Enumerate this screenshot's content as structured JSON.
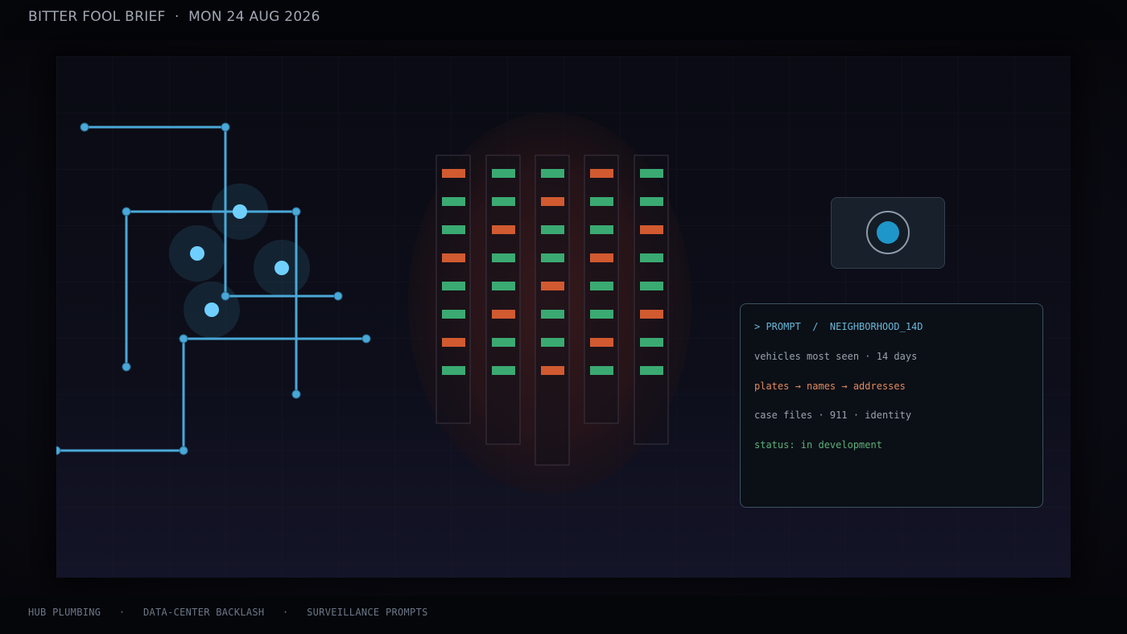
{
  "header": {
    "title": "BITTER FOOL BRIEF  ·  MON 24 AUG 2026"
  },
  "illustration": {
    "circuit_color": "#4aa8d8",
    "node_glow_color": "#6fd0ff",
    "plate_green": "#3aaa72",
    "plate_orange": "#d15a30",
    "plate_columns": [
      [
        "orange",
        "green",
        "green",
        "orange",
        "green",
        "green",
        "orange",
        "green"
      ],
      [
        "green",
        "green",
        "orange",
        "green",
        "green",
        "orange",
        "green",
        "green"
      ],
      [
        "green",
        "orange",
        "green",
        "green",
        "orange",
        "green",
        "green",
        "orange"
      ],
      [
        "orange",
        "green",
        "green",
        "orange",
        "green",
        "green",
        "orange",
        "green"
      ],
      [
        "green",
        "green",
        "orange",
        "green",
        "green",
        "orange",
        "green",
        "green"
      ]
    ],
    "camera_icon": "camera-lens-icon"
  },
  "prompt_panel": {
    "line1": "> PROMPT  /  NEIGHBORHOOD_14D",
    "line2": "vehicles most seen · 14 days",
    "line3": "plates → names → addresses",
    "line4": "case files · 911 · identity",
    "line5": "status: in development",
    "colors": {
      "line1": "#6ab6d6",
      "line2": "#9aa3ae",
      "line3": "#e08a5c",
      "line4": "#9aa3ae",
      "line5": "#5cb07a"
    }
  },
  "footer": {
    "text": "HUB PLUMBING   ·   DATA-CENTER BACKLASH   ·   SURVEILLANCE PROMPTS"
  }
}
